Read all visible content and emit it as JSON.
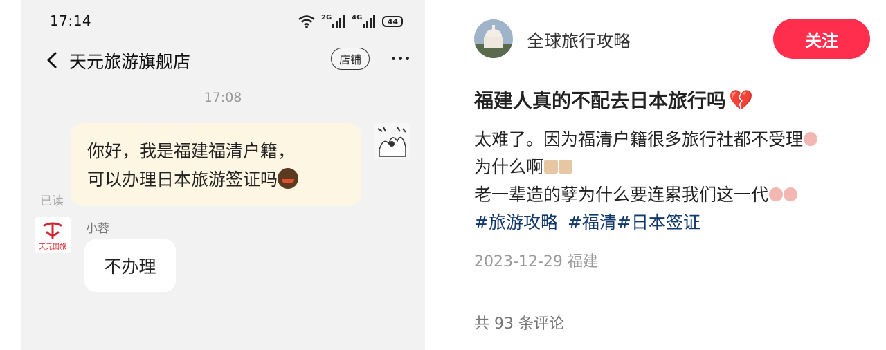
{
  "status_bar": {
    "time": "17:14",
    "signal_1_tag": "2G",
    "signal_2_tag": "4G",
    "battery": "44"
  },
  "chat": {
    "title": "天元旅游旗舰店",
    "store_label": "店铺",
    "timestamp": "17:08",
    "my_message_line1": "你好，我是福建福清户籍，",
    "my_message_line2": "可以办理日本旅游签证吗",
    "read_status": "已读",
    "shop_logo_text": "天元国旅",
    "agent_name": "小蓉",
    "reply": "不办理"
  },
  "post": {
    "author": "全球旅行攻略",
    "follow_label": "关注",
    "title": "福建人真的不配去日本旅行吗",
    "title_emoji": "💔",
    "body_line1": "太难了。因为福清户籍很多旅行社都不受理",
    "body_line2": "为什么啊",
    "body_line3": "老一辈造的孽为什么要连累我们这一代",
    "tags": [
      "#旅游攻略",
      "#福清",
      "#日本签证"
    ],
    "date": "2023-12-29",
    "location": "福建",
    "comments": "共 93 条评论"
  },
  "colors": {
    "follow_button": "#ff2e4d",
    "tag": "#13386c",
    "my_bubble": "#fdf6e3",
    "chat_background": "#f2f2f2"
  },
  "icons": [
    "back-arrow-icon",
    "wifi-icon",
    "signal-icon",
    "battery-icon",
    "more-icon",
    "heart-broken-icon"
  ]
}
